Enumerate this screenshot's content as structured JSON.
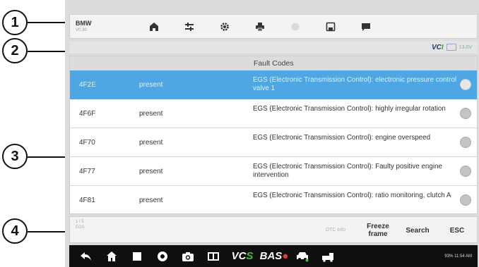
{
  "callouts": [
    "1",
    "2",
    "3",
    "4"
  ],
  "topbar": {
    "vehicle_make": "BMW",
    "vehicle_version": "V0.30",
    "icons": [
      "home-icon",
      "vehicle-swap-icon",
      "settings-icon",
      "print-icon",
      "help-icon",
      "save-icon",
      "data-logging-icon"
    ]
  },
  "status": {
    "vci_label": "VC",
    "vci_suffix": "I",
    "battery_text": "13.0V"
  },
  "table": {
    "header": "Fault Codes",
    "rows": [
      {
        "code": "4F2E",
        "status": "present",
        "description": "EGS (Electronic Transmission Control): electronic pressure control valve 1",
        "selected": true
      },
      {
        "code": "4F6F",
        "status": "present",
        "description": "EGS (Electronic Transmission Control): highly irregular rotation",
        "selected": false
      },
      {
        "code": "4F70",
        "status": "present",
        "description": "EGS (Electronic Transmission Control): engine overspeed",
        "selected": false
      },
      {
        "code": "4F77",
        "status": "present",
        "description": "EGS (Electronic Transmission Control): Faulty positive engine intervention",
        "selected": false
      },
      {
        "code": "4F81",
        "status": "present",
        "description": "EGS (Electronic Transmission Control): ratio monitoring, clutch A",
        "selected": false
      }
    ]
  },
  "bottom": {
    "info_line1": "1 / 5",
    "info_line2": "EGS",
    "dtc_info_label": "DTC Info",
    "freeze_frame_label": "Freeze\nframe",
    "search_label": "Search",
    "esc_label": "ESC"
  },
  "navbar": {
    "icons": [
      "back-icon",
      "android-home-icon",
      "recent-apps-icon",
      "chrome-icon",
      "camera-icon",
      "screen-mirror-icon"
    ],
    "vcs_text": "VC",
    "vcs_suffix": "S",
    "bas_text": "BAS",
    "bas_dot": "●",
    "clock_text": "93% 11:54 AM"
  },
  "colors": {
    "selected_row": "#4ea6e2",
    "navbar": "#0f0f0f",
    "vci_blue": "#1a3d6b",
    "vci_green": "#3a9b3a"
  }
}
